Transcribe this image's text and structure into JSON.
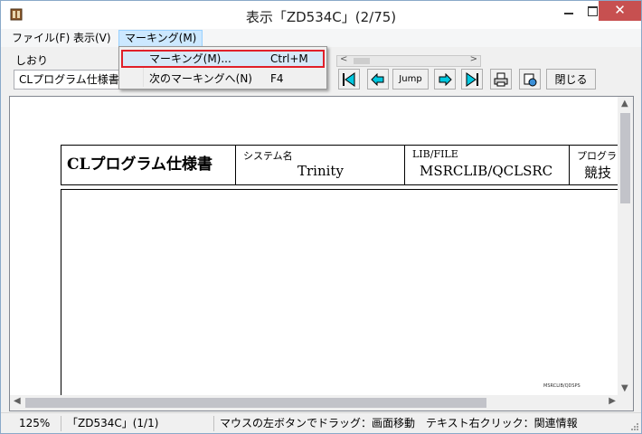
{
  "window": {
    "title": "表示「ZD534C」(2/75)",
    "close_glyph": "✕"
  },
  "menubar": {
    "file": "ファイル(F)",
    "view": "表示(V)",
    "marking": "マーキング(M)"
  },
  "dropdown": {
    "items": [
      {
        "label": "マーキング(M)...",
        "shortcut": "Ctrl+M"
      },
      {
        "label": "次のマーキングへ(N)",
        "shortcut": "F4"
      }
    ]
  },
  "toolbar": {
    "bookmark_label": "しおり",
    "bookmark_value": "CLプログラム仕様書",
    "jump_label": "Jump",
    "close_label": "閉じる"
  },
  "document": {
    "title": "CLプログラム仕様書",
    "system_label": "システム名",
    "system_value": "Trinity",
    "lib_label": "LIB/FILE",
    "lib_value": "MSRCLIB/QCLSRC",
    "program_label": "プログラ",
    "program_value": "競技",
    "footer_tiny": "MSRCLIB/QDSPS"
  },
  "status": {
    "zoom": "125%",
    "page": "「ZD534C」(1/1)",
    "hint": "マウスの左ボタンでドラッグ：画面移動　テキスト右クリック：関連情報"
  },
  "colors": {
    "highlight_border": "#e0202a",
    "menu_active": "#cce8ff"
  }
}
